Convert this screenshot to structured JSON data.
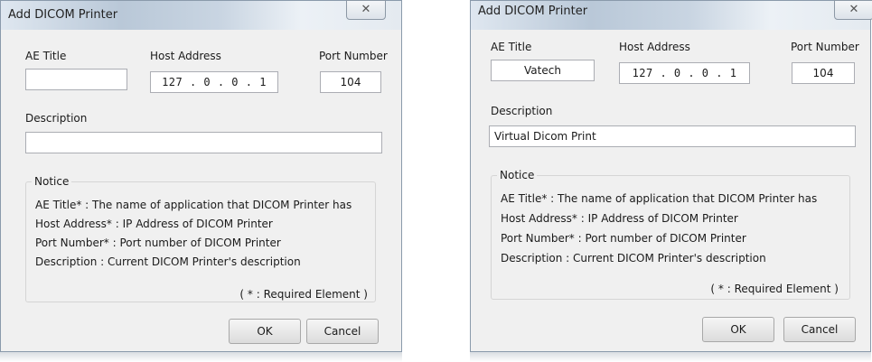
{
  "left": {
    "title": "Add DICOM Printer",
    "close_glyph": "✕",
    "labels": {
      "ae_title": "AE Title",
      "host_address": "Host Address",
      "port_number": "Port Number",
      "description": "Description"
    },
    "values": {
      "ae_title": "",
      "host_address": "127 .  0  .  0  .  1",
      "port_number": "104",
      "description": ""
    },
    "notice": {
      "title": "Notice",
      "lines": [
        "AE Title* : The name of application that DICOM Printer has",
        "Host Address* : IP Address of DICOM Printer",
        "Port Number* : Port number of DICOM Printer",
        "Description : Current DICOM Printer's description"
      ],
      "required_note": "( * : Required Element )"
    },
    "buttons": {
      "ok": "OK",
      "cancel": "Cancel"
    }
  },
  "right": {
    "title": "Add DICOM Printer",
    "close_glyph": "✕",
    "labels": {
      "ae_title": "AE Title",
      "host_address": "Host Address",
      "port_number": "Port Number",
      "description": "Description"
    },
    "values": {
      "ae_title": "Vatech",
      "host_address": "127 .  0  .  0  .  1",
      "port_number": "104",
      "description": "Virtual Dicom Print"
    },
    "notice": {
      "title": "Notice",
      "lines": [
        "AE Title* : The name of application that DICOM Printer has",
        "Host Address* : IP Address of DICOM Printer",
        "Port Number* : Port number of DICOM Printer",
        "Description : Current DICOM Printer's description"
      ],
      "required_note": "( * : Required Element )"
    },
    "buttons": {
      "ok": "OK",
      "cancel": "Cancel"
    }
  },
  "icons": {
    "close": "close-icon"
  }
}
